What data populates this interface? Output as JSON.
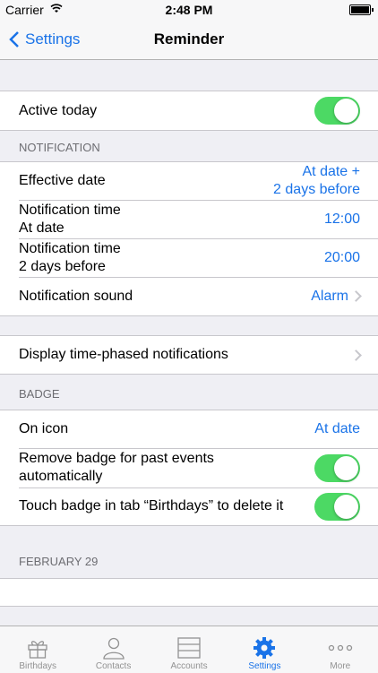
{
  "status": {
    "carrier": "Carrier",
    "time": "2:48 PM"
  },
  "nav": {
    "back": "Settings",
    "title": "Reminder"
  },
  "active_today": {
    "label": "Active today",
    "on": true
  },
  "notification": {
    "header": "NOTIFICATION",
    "effective_date": {
      "label": "Effective date",
      "value_line1": "At date +",
      "value_line2": "2 days before"
    },
    "time_at_date": {
      "label_line1": "Notification time",
      "label_line2": "At date",
      "value": "12:00"
    },
    "time_before": {
      "label_line1": "Notification time",
      "label_line2": "2 days before",
      "value": "20:00"
    },
    "sound": {
      "label": "Notification sound",
      "value": "Alarm"
    }
  },
  "phased": {
    "label": "Display time-phased notifications"
  },
  "badge": {
    "header": "BADGE",
    "on_icon": {
      "label": "On icon",
      "value": "At date"
    },
    "remove_past": {
      "label_line1": "Remove badge for past events",
      "label_line2": "automatically",
      "on": true
    },
    "touch_delete": {
      "label": "Touch badge in tab “Birthdays” to delete it",
      "on": true
    }
  },
  "feb29": {
    "header": "FEBRUARY 29"
  },
  "tabs": [
    {
      "label": "Birthdays",
      "icon": "gift-icon"
    },
    {
      "label": "Contacts",
      "icon": "person-icon"
    },
    {
      "label": "Accounts",
      "icon": "accounts-icon"
    },
    {
      "label": "Settings",
      "icon": "gear-icon",
      "active": true
    },
    {
      "label": "More",
      "icon": "more-icon"
    }
  ],
  "colors": {
    "accent": "#1a73e8",
    "toggle_on": "#4cd964",
    "background": "#efeff4"
  }
}
